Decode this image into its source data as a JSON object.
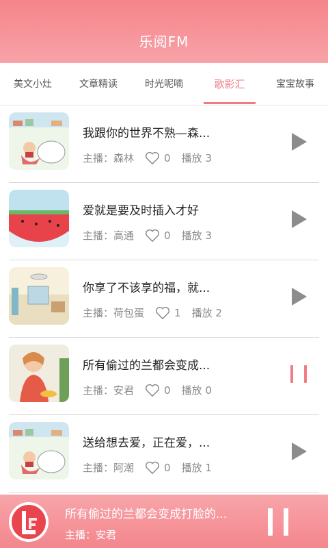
{
  "app": {
    "title": "乐阅FM"
  },
  "tabs": [
    {
      "label": "美文小灶"
    },
    {
      "label": "文章精读"
    },
    {
      "label": "时光呢喃"
    },
    {
      "label": "歌影汇",
      "active": true
    },
    {
      "label": "宝宝故事"
    }
  ],
  "items": [
    {
      "title": "我跟你的世界不熟—森...",
      "anchor": "主播：森林",
      "likes": "0",
      "plays": "播放 3",
      "state": "play"
    },
    {
      "title": "爱就是要及时插入才好",
      "anchor": "主播：高通",
      "likes": "0",
      "plays": "播放 3",
      "state": "play"
    },
    {
      "title": "你享了不该享的福，就...",
      "anchor": "主播：荷包蛋",
      "likes": "1",
      "plays": "播放 2",
      "state": "play"
    },
    {
      "title": "所有偷过的兰都会变成...",
      "anchor": "主播：安君",
      "likes": "0",
      "plays": "播放 0",
      "state": "pause"
    },
    {
      "title": "送给想去爱，正在爱，...",
      "anchor": "主播：阿潮",
      "likes": "0",
      "plays": "播放 1",
      "state": "play"
    }
  ],
  "player": {
    "title": "所有偷过的兰都会变成打脸的...",
    "anchor": "主播：安君"
  },
  "colors": {
    "accent": "#f07d86",
    "header": "#f5848a"
  }
}
